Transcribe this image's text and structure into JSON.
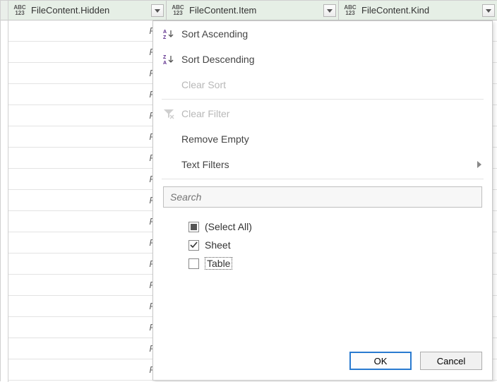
{
  "columns": {
    "hidden": {
      "label": "FileContent.Hidden"
    },
    "item": {
      "label": "FileContent.Item"
    },
    "kind": {
      "label": "FileContent.Kind"
    }
  },
  "rowCount": 17,
  "cellTruncated": "FA",
  "menu": {
    "sort_asc": "Sort Ascending",
    "sort_desc": "Sort Descending",
    "clear_sort": "Clear Sort",
    "clear_filter": "Clear Filter",
    "remove_empty": "Remove Empty",
    "text_filters": "Text Filters",
    "search_placeholder": "Search",
    "options": {
      "select_all": {
        "label": "(Select All)",
        "state": "indeterminate"
      },
      "sheet": {
        "label": "Sheet",
        "state": "checked"
      },
      "table": {
        "label": "Table",
        "state": "unchecked",
        "focused": true
      }
    },
    "ok": "OK",
    "cancel": "Cancel"
  }
}
